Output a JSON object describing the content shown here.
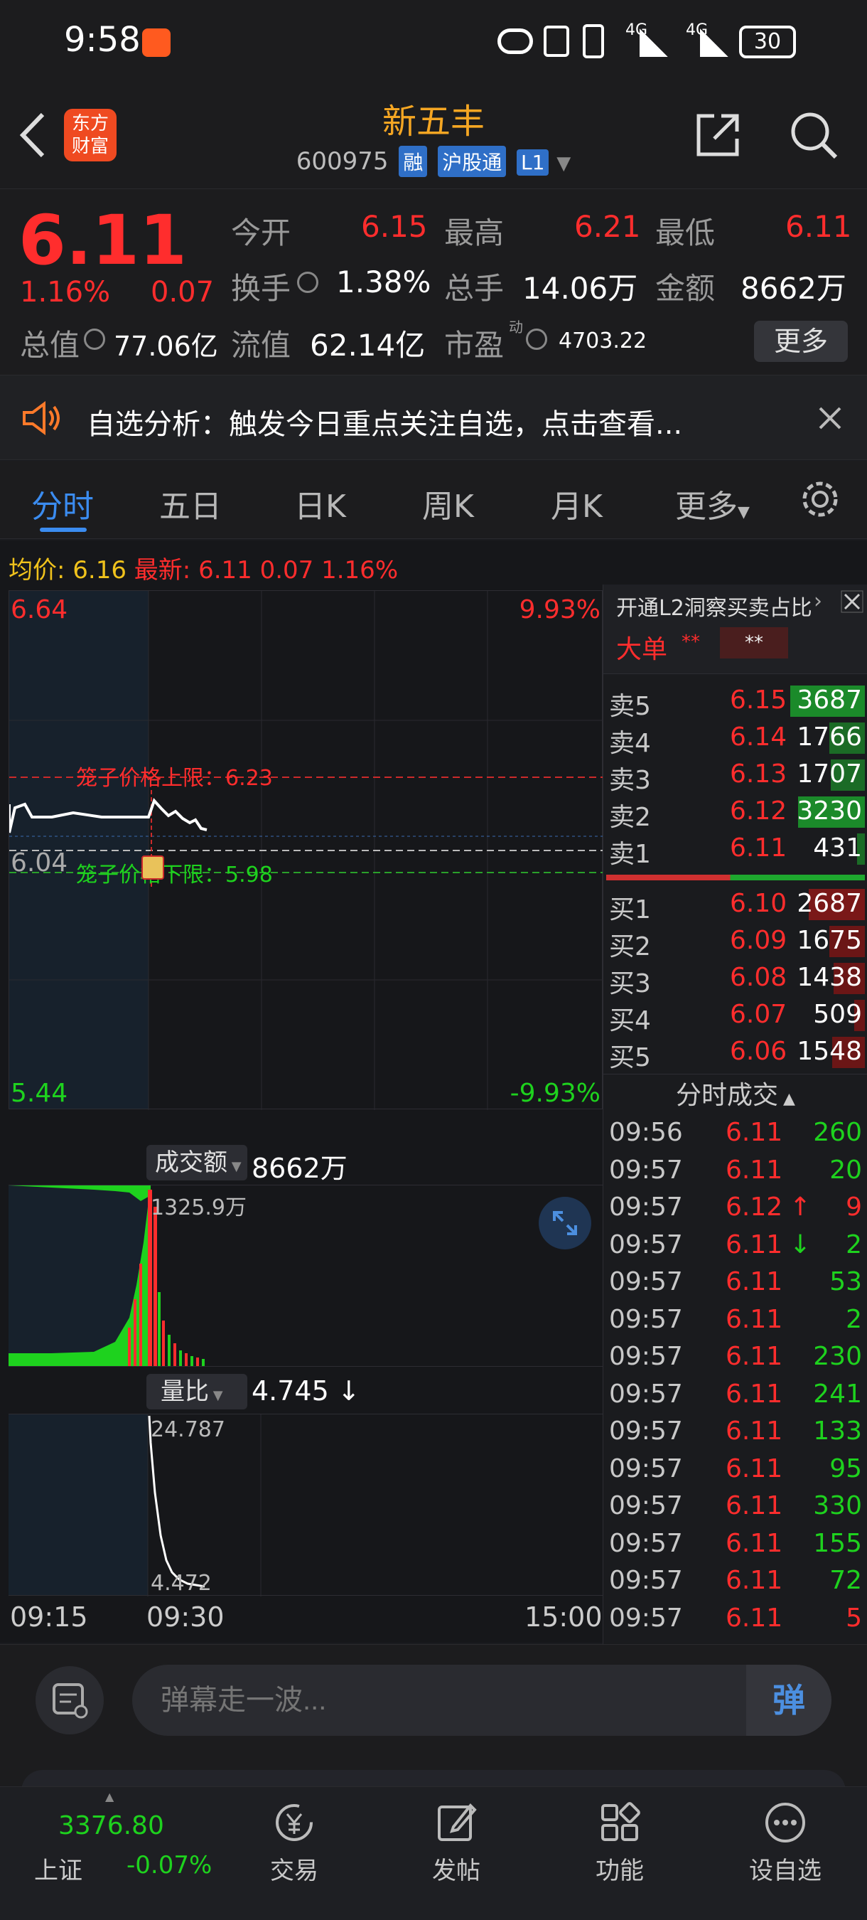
{
  "status_bar": {
    "time": "9:58",
    "network": "4G",
    "battery": "30"
  },
  "header": {
    "app_logo_text": "东方\n财富",
    "stock_name": "新五丰",
    "stock_code": "600975",
    "tags": [
      "融",
      "沪股通",
      "L1"
    ]
  },
  "quote": {
    "price": "6.11",
    "change_pct": "1.16%",
    "change": "0.07",
    "open_label": "今开",
    "open": "6.15",
    "high_label": "最高",
    "high": "6.21",
    "low_label": "最低",
    "low": "6.11",
    "turnover_label": "换手",
    "turnover": "1.38%",
    "volume_label": "总手",
    "volume": "14.06万",
    "amount_label": "金额",
    "amount": "8662万",
    "mktcap_label": "总值",
    "mktcap": "77.06亿",
    "float_label": "流值",
    "float": "62.14亿",
    "pe_label": "市盈",
    "pe_sup": "动",
    "pe": "4703.22",
    "more_button": "更多"
  },
  "notice": {
    "text": "自选分析：触发今日重点关注自选，点击查看..."
  },
  "tabs": {
    "items": [
      "分时",
      "五日",
      "日K",
      "周K",
      "月K",
      "更多"
    ],
    "active": "分时"
  },
  "intraday": {
    "avg_label": "均价:",
    "avg": "6.16",
    "latest_label": "最新:",
    "latest": "6.11",
    "latest_change": "0.07",
    "latest_pct": "1.16%",
    "y_top": "6.64",
    "y_mid": "6.04",
    "y_bottom": "5.44",
    "pct_top": "9.93%",
    "pct_bottom": "-9.93%",
    "cage_upper": "笼子价格上限：6.23",
    "cage_lower": "笼子价格下限：5.98",
    "amount_label": "成交额",
    "amount_value": "8662万",
    "amount_peak": "1325.9万",
    "ratio_label": "量比",
    "ratio_value": "4.745 ↓",
    "ratio_peak": "24.787",
    "ratio_low": "4.472",
    "x_start": "09:15",
    "x_open": "09:30",
    "x_end": "15:00"
  },
  "level2": {
    "title": "开通L2洞察买卖占比",
    "big_order_label": "大单",
    "big_order_val1": "**",
    "big_order_val2": "**"
  },
  "order_book": {
    "sells": [
      {
        "label": "卖5",
        "price": "6.15",
        "vol": "3687",
        "bar": 0.95,
        "color": "#1b8a2a"
      },
      {
        "label": "卖4",
        "price": "6.14",
        "vol": "1766",
        "bar": 0.45,
        "color": "#1b6b26"
      },
      {
        "label": "卖3",
        "price": "6.13",
        "vol": "1707",
        "bar": 0.44,
        "color": "#1b6b26"
      },
      {
        "label": "卖2",
        "price": "6.12",
        "vol": "3230",
        "bar": 0.85,
        "color": "#1b8a2a"
      },
      {
        "label": "卖1",
        "price": "6.11",
        "vol": "431",
        "bar": 0.1,
        "color": "#1b6b26"
      }
    ],
    "buys": [
      {
        "label": "买1",
        "price": "6.10",
        "vol": "2687",
        "bar": 0.72,
        "color": "#7a1818"
      },
      {
        "label": "买2",
        "price": "6.09",
        "vol": "1675",
        "bar": 0.45,
        "color": "#6b1616"
      },
      {
        "label": "买3",
        "price": "6.08",
        "vol": "1438",
        "bar": 0.4,
        "color": "#6b1616"
      },
      {
        "label": "买4",
        "price": "6.07",
        "vol": "509",
        "bar": 0.14,
        "color": "#6b1616"
      },
      {
        "label": "买5",
        "price": "6.06",
        "vol": "1548",
        "bar": 0.42,
        "color": "#6b1616"
      }
    ]
  },
  "trades": {
    "title": "分时成交",
    "rows": [
      {
        "t": "09:56",
        "p": "6.11",
        "v": "260",
        "dir": "",
        "vc": "green"
      },
      {
        "t": "09:57",
        "p": "6.11",
        "v": "20",
        "dir": "",
        "vc": "green"
      },
      {
        "t": "09:57",
        "p": "6.12",
        "v": "9",
        "dir": "↑",
        "vc": "red"
      },
      {
        "t": "09:57",
        "p": "6.11",
        "v": "2",
        "dir": "↓",
        "vc": "green"
      },
      {
        "t": "09:57",
        "p": "6.11",
        "v": "53",
        "dir": "",
        "vc": "green"
      },
      {
        "t": "09:57",
        "p": "6.11",
        "v": "2",
        "dir": "",
        "vc": "green"
      },
      {
        "t": "09:57",
        "p": "6.11",
        "v": "230",
        "dir": "",
        "vc": "green"
      },
      {
        "t": "09:57",
        "p": "6.11",
        "v": "241",
        "dir": "",
        "vc": "green"
      },
      {
        "t": "09:57",
        "p": "6.11",
        "v": "133",
        "dir": "",
        "vc": "green"
      },
      {
        "t": "09:57",
        "p": "6.11",
        "v": "95",
        "dir": "",
        "vc": "green"
      },
      {
        "t": "09:57",
        "p": "6.11",
        "v": "330",
        "dir": "",
        "vc": "green"
      },
      {
        "t": "09:57",
        "p": "6.11",
        "v": "155",
        "dir": "",
        "vc": "green"
      },
      {
        "t": "09:57",
        "p": "6.11",
        "v": "72",
        "dir": "",
        "vc": "green"
      },
      {
        "t": "09:57",
        "p": "6.11",
        "v": "5",
        "dir": "",
        "vc": "red"
      }
    ]
  },
  "comment": {
    "placeholder": "弹幕走一波...",
    "danmaku_button": "弹"
  },
  "navbar": {
    "index_value": "3376.80",
    "index_name": "上证",
    "index_change": "-0.07%",
    "items": [
      "交易",
      "发帖",
      "功能",
      "设自选"
    ]
  }
}
